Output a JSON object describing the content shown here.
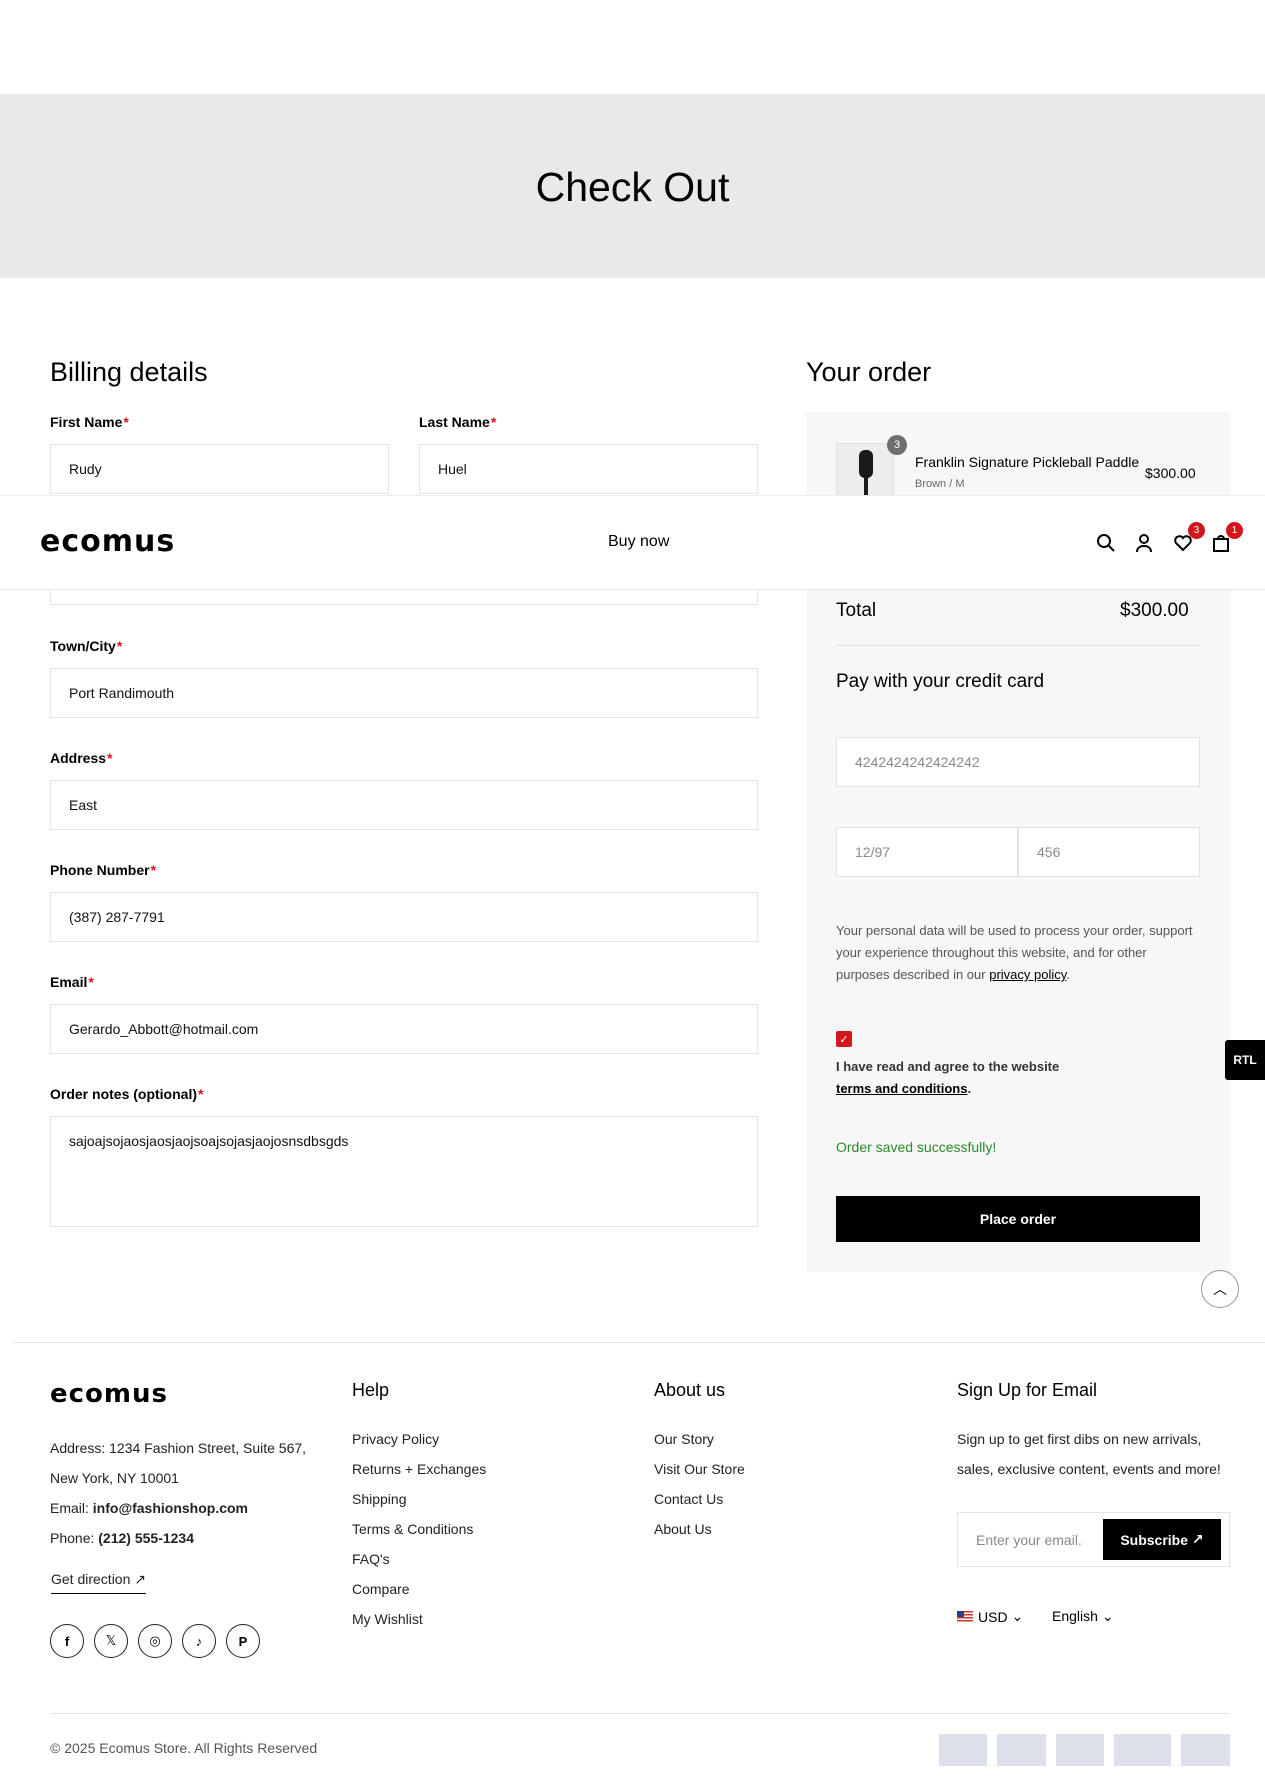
{
  "hero": {
    "title": "Check Out"
  },
  "billing": {
    "title": "Billing details",
    "first_name": {
      "label": "First Name",
      "value": "Rudy"
    },
    "last_name": {
      "label": "Last Name",
      "value": "Huel"
    },
    "town": {
      "label": "Town/City",
      "value": "Port Randimouth"
    },
    "address": {
      "label": "Address",
      "value": "East"
    },
    "phone": {
      "label": "Phone Number",
      "value": "(387) 287-7791"
    },
    "email": {
      "label": "Email",
      "value": "Gerardo_Abbott@hotmail.com"
    },
    "notes": {
      "label": "Order notes (optional)",
      "value": "sajoajsojaosjaosjaojsoajsojasjaojosnsdbsgds"
    },
    "required_mark": "*"
  },
  "order": {
    "title": "Your order",
    "item": {
      "name": "Franklin Signature Pickleball Paddle",
      "variant": "Brown / M",
      "price": "$300.00",
      "qty": "3"
    },
    "total_label": "Total",
    "total_value": "$300.00",
    "pay_title": "Pay with your credit card",
    "card_number": "4242424242424242",
    "card_expiry": "12/97",
    "card_cvc": "456",
    "privacy_text": "Your personal data will be used to process your order, support your experience throughout this website, and for other purposes described in our",
    "privacy_link": "privacy policy",
    "agree_text": "I have read and agree to the website",
    "terms_link": "terms and conditions",
    "success": "Order saved successfully!",
    "place_order": "Place order"
  },
  "header": {
    "logo": "ecomus",
    "nav": "Buy now",
    "wishlist_count": "3",
    "cart_count": "1",
    "icons": [
      "search-icon",
      "user-icon",
      "heart-icon",
      "bag-icon"
    ]
  },
  "rtl": "RTL",
  "footer": {
    "logo": "ecomus",
    "address": "Address: 1234 Fashion Street, Suite 567,",
    "address2": "New York, NY 10001",
    "email_label": "Email:",
    "email": "info@fashionshop.com",
    "phone_label": "Phone:",
    "phone": "(212) 555-1234",
    "direction": "Get direction",
    "help_title": "Help",
    "help_links": [
      "Privacy Policy",
      "Returns + Exchanges",
      "Shipping",
      "Terms & Conditions",
      "FAQ's",
      "Compare",
      "My Wishlist"
    ],
    "about_title": "About us",
    "about_links": [
      "Our Story",
      "Visit Our Store",
      "Contact Us",
      "About Us"
    ],
    "signup_title": "Sign Up for Email",
    "signup_text1": "Sign up to get first dibs on new arrivals,",
    "signup_text2": "sales, exclusive content, events and more!",
    "email_placeholder": "Enter your email.",
    "subscribe": "Subscribe",
    "currency": "USD",
    "language": "English",
    "copyright": "© 2025 Ecomus Store. All Rights Reserved",
    "social_icons": [
      "facebook-icon",
      "x-icon",
      "instagram-icon",
      "tiktok-icon",
      "pinterest-icon"
    ]
  },
  "colors": {
    "accent": "#d4151c",
    "success": "#2a8a2a",
    "hero_bg": "#e9e9e9"
  }
}
